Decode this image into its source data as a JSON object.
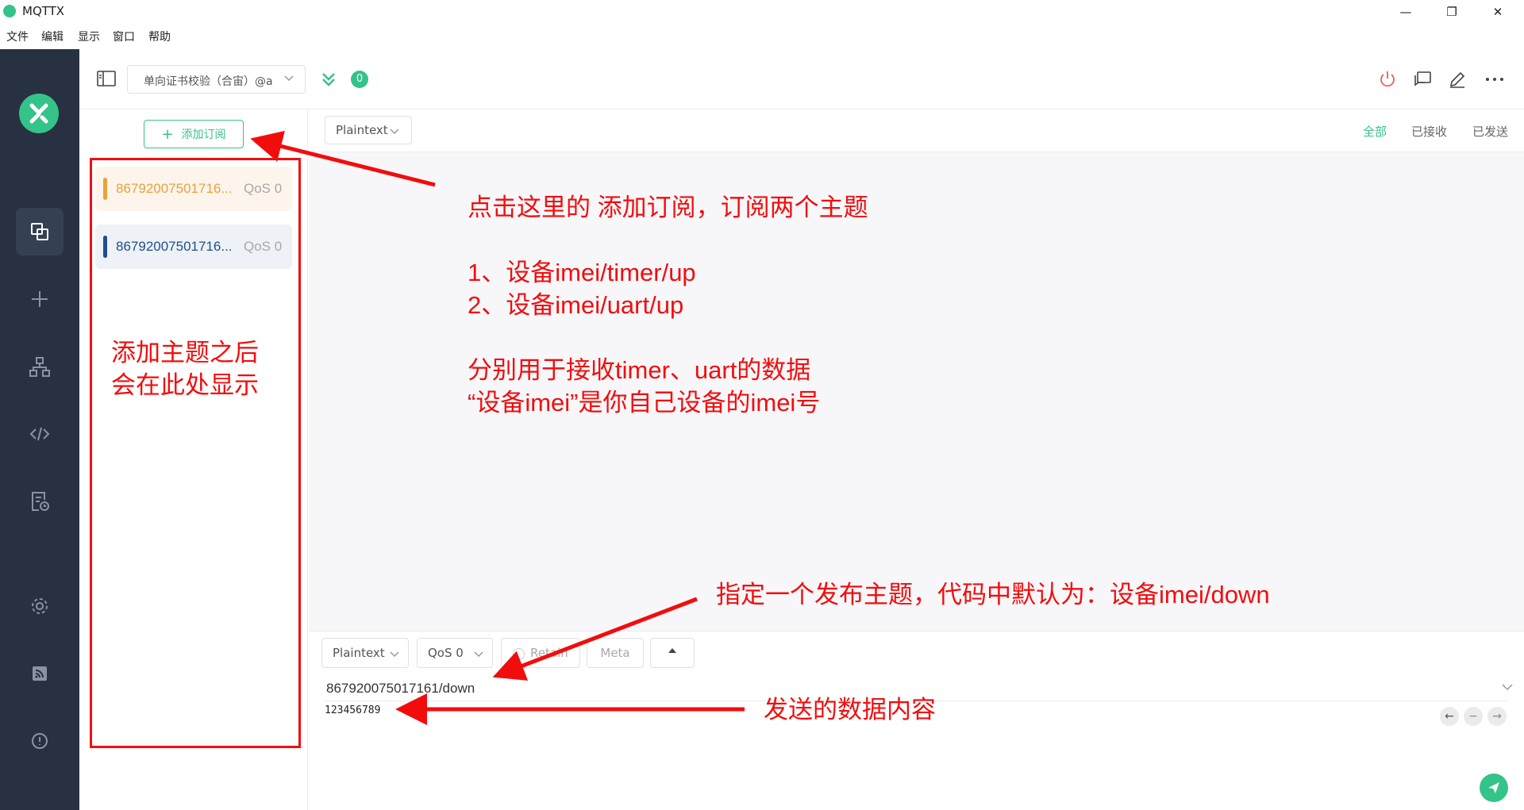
{
  "window": {
    "title": "MQTTX",
    "minimize": "—",
    "restore": "❐",
    "close": "✕"
  },
  "menu": [
    "文件",
    "编辑",
    "显示",
    "窗口",
    "帮助"
  ],
  "header": {
    "connection_name": "单向证书校验（合宙）@a",
    "unread_count": "0"
  },
  "subscriptions": {
    "add_label": "添加订阅",
    "items": [
      {
        "topic": "86792007501716...",
        "qos": "QoS 0",
        "color": "#e8a33a",
        "bg": "#fdf4ec"
      },
      {
        "topic": "86792007501716...",
        "qos": "QoS 0",
        "color": "#1e4f8c",
        "bg": "#eef1f6"
      }
    ]
  },
  "messages": {
    "payload_type": "Plaintext",
    "filters": {
      "all": "全部",
      "received": "已接收",
      "sent": "已发送"
    }
  },
  "publish": {
    "payload_type": "Plaintext",
    "qos": "QoS 0",
    "retain": "Retain",
    "meta": "Meta",
    "topic": "867920075017161/down",
    "payload": "123456789"
  },
  "annotations": {
    "main": "点击这里的 添加订阅，订阅两个主题\n\n1、设备imei/timer/up\n2、设备imei/uart/up\n\n分别用于接收timer、uart的数据\n“设备imei”是你自己设备的imei号",
    "panel": "添加主题之后\n会在此处显示",
    "topic": "指定一个发布主题，代码中默认为：设备imei/down",
    "payload": "发送的数据内容"
  },
  "colors": {
    "accent": "#34c388",
    "annotation": "#f20d0d",
    "nav_bg": "#283141"
  }
}
